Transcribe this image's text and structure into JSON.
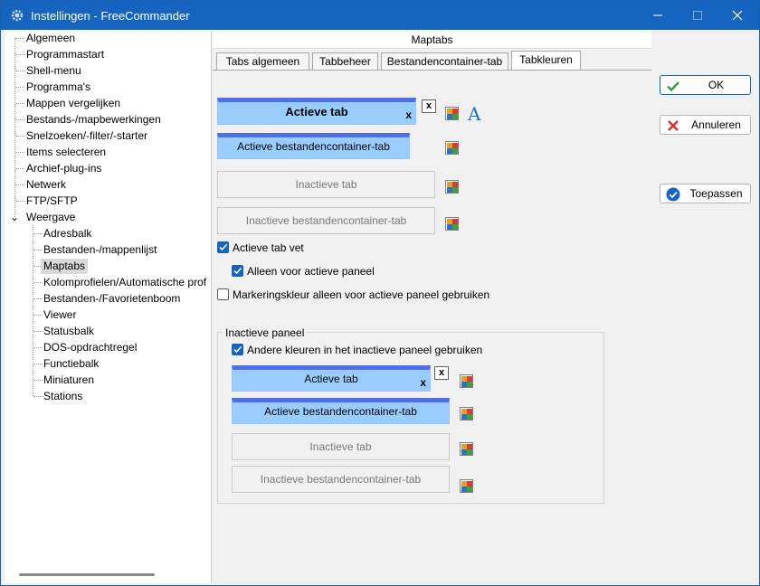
{
  "window": {
    "title": "Instellingen - FreeCommander",
    "controls": {
      "minimize": "—",
      "maximize": "☐",
      "close": "✕"
    }
  },
  "tree": {
    "items": [
      {
        "label": "Algemeen"
      },
      {
        "label": "Programmastart"
      },
      {
        "label": "Shell-menu"
      },
      {
        "label": "Programma's"
      },
      {
        "label": "Mappen vergelijken"
      },
      {
        "label": "Bestands-/mapbewerkingen"
      },
      {
        "label": "Snelzoeken/-filter/-starter"
      },
      {
        "label": "Items selecteren"
      },
      {
        "label": "Archief-plug-ins"
      },
      {
        "label": "Netwerk"
      },
      {
        "label": "FTP/SFTP"
      },
      {
        "label": "Weergave",
        "expander": "⌄"
      }
    ],
    "children": [
      {
        "label": "Adresbalk"
      },
      {
        "label": "Bestanden-/mappenlijst"
      },
      {
        "label": "Maptabs",
        "selected": true
      },
      {
        "label": "Kolomprofielen/Automatische prof"
      },
      {
        "label": "Bestanden-/Favorietenboom"
      },
      {
        "label": "Viewer"
      },
      {
        "label": "Statusbalk"
      },
      {
        "label": "DOS-opdrachtregel"
      },
      {
        "label": "Functiebalk"
      },
      {
        "label": "Miniaturen"
      },
      {
        "label": "Stations"
      }
    ]
  },
  "panel": {
    "header": "Maptabs",
    "tabs": [
      {
        "label": "Tabs algemeen"
      },
      {
        "label": "Tabbeheer"
      },
      {
        "label": "Bestandencontainer-tab"
      },
      {
        "label": "Tabkleuren",
        "active": true
      }
    ],
    "swatches": {
      "active_tab": "Actieve tab",
      "active_tab_close": "x",
      "close_box": "x",
      "font_glyph": "A",
      "active_container_tab": "Actieve bestandencontainer-tab",
      "inactive_tab": "Inactieve tab",
      "inactive_container_tab": "Inactieve bestandencontainer-tab"
    },
    "options": {
      "active_tab_bold": {
        "label": "Actieve tab vet",
        "checked": true
      },
      "only_active_panel": {
        "label": "Alleen voor actieve paneel",
        "checked": true
      },
      "marking_color": {
        "label": "Markeringskleur alleen voor actieve paneel gebruiken",
        "checked": false
      }
    },
    "inactive_group": {
      "title": "Inactieve paneel",
      "other_colors": {
        "label": "Andere kleuren in het inactieve paneel gebruiken",
        "checked": true
      },
      "active_tab": "Actieve tab",
      "active_tab_close": "x",
      "close_box": "x",
      "active_container_tab": "Actieve bestandencontainer-tab",
      "inactive_tab": "Inactieve tab",
      "inactive_container_tab": "Inactieve bestandencontainer-tab"
    }
  },
  "buttons": {
    "ok": "OK",
    "cancel": "Annuleren",
    "apply": "Toepassen"
  },
  "colors": {
    "titlebar": "#1565c0",
    "active_swatch": "#99ccff",
    "active_swatch_border": "#4f6fe8",
    "checkbox_on": "#1565c0"
  }
}
